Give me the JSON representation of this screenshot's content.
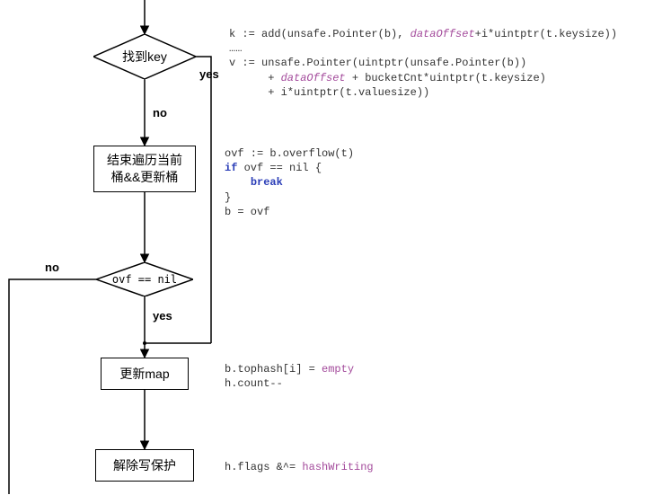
{
  "flow": {
    "decision_find_key": {
      "label": "找到key"
    },
    "decision_ovf_nil": {
      "label": "ovf == nil"
    },
    "step_end_iter": {
      "line1": "结束遍历当前",
      "line2": "桶&&更新桶"
    },
    "step_update_map": {
      "label": "更新map"
    },
    "step_release_lock": {
      "label": "解除写保护"
    }
  },
  "edges": {
    "yes_key": "yes",
    "no_key": "no",
    "yes_ovf": "yes",
    "no_ovf": "no"
  },
  "code": {
    "block1": {
      "l1a": "k := add(unsafe.Pointer(b), ",
      "l1_id": "dataOffset",
      "l1b": "+i*uintptr(t.keysize))",
      "l2": "……",
      "l3": "v := unsafe.Pointer(uintptr(unsafe.Pointer(b))",
      "l4a": "      + ",
      "l4_id": "dataOffset",
      "l4b": " + bucketCnt*uintptr(t.keysize)",
      "l5": "      + i*uintptr(t.valuesize))"
    },
    "block2": {
      "l1": "ovf := b.overflow(t)",
      "l2a": "if",
      "l2b": " ovf == nil {",
      "l3a": "    ",
      "l3_kw": "break",
      "l4": "}",
      "l5": "b = ovf"
    },
    "block3": {
      "l1a": "b.tophash[i] = ",
      "l1_id": "empty",
      "l2": "h.count--"
    },
    "block4": {
      "l1a": "h.flags &^= ",
      "l1_id": "hashWriting"
    }
  }
}
